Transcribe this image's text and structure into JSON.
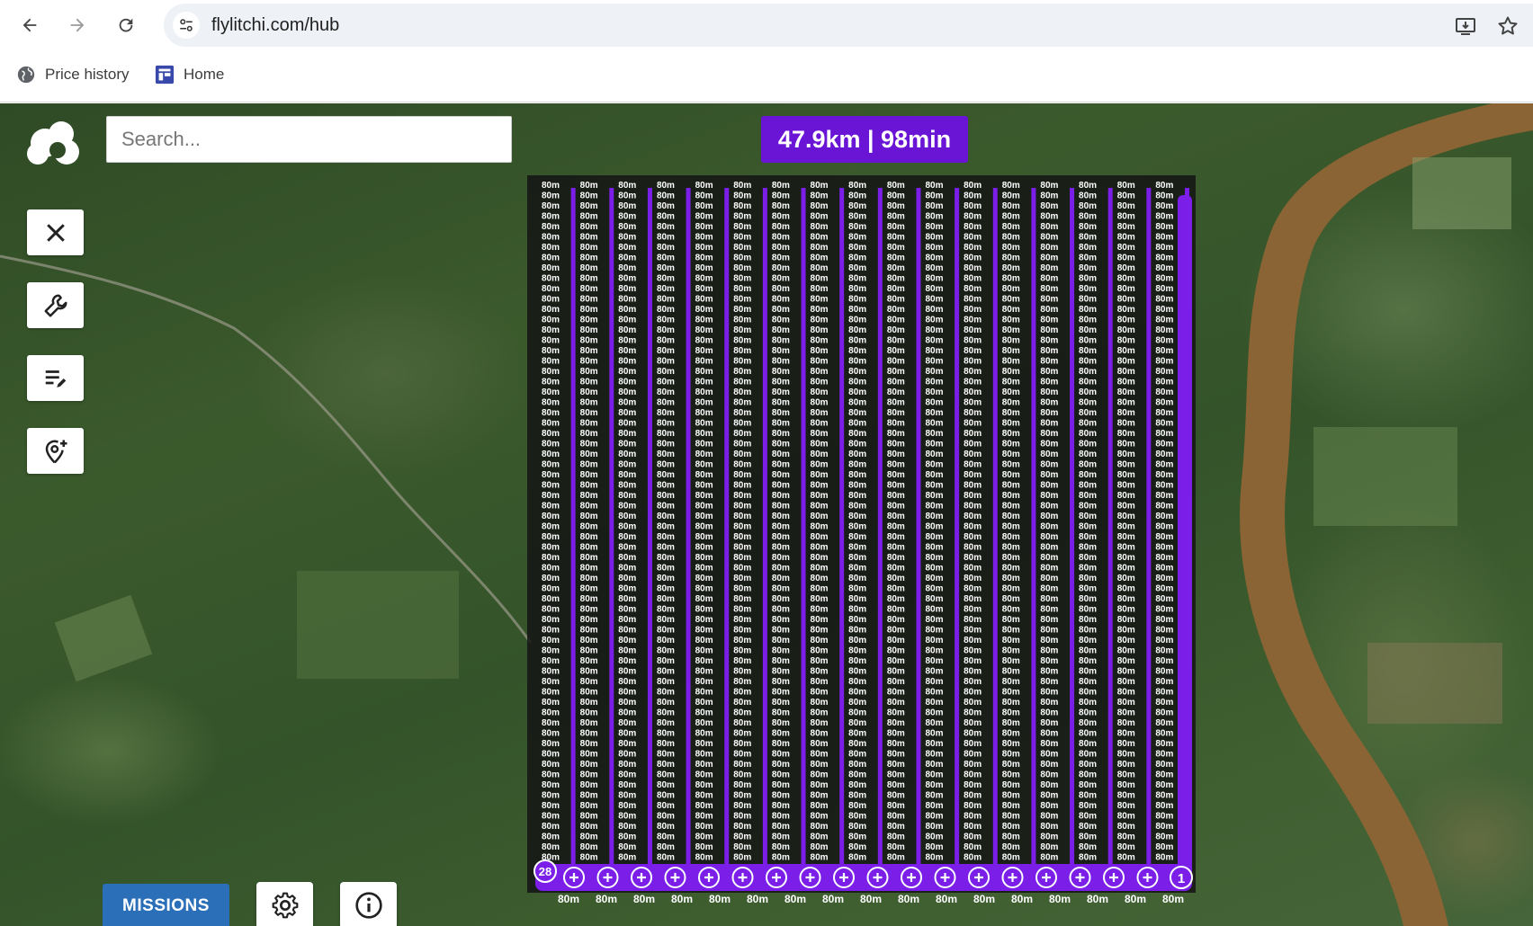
{
  "browser": {
    "url": "flylitchi.com/hub",
    "back_icon": "arrow-left-icon",
    "forward_icon": "arrow-right-icon",
    "reload_icon": "reload-icon",
    "install_icon": "install-app-icon",
    "bookmark_star_icon": "star-icon",
    "bookmarks": [
      {
        "label": "Price history",
        "icon": "globe-icon"
      },
      {
        "label": "Home",
        "icon": "dashboard-icon"
      }
    ]
  },
  "map": {
    "search": {
      "placeholder": "Search..."
    },
    "stats_label": "47.9km | 98min",
    "tools": [
      {
        "name": "close",
        "icon": "close-icon"
      },
      {
        "name": "settings-tools",
        "icon": "wrench-icon"
      },
      {
        "name": "edit-list",
        "icon": "edit-list-icon"
      },
      {
        "name": "add-poi",
        "icon": "add-location-icon"
      }
    ],
    "missions_label": "MISSIONS",
    "settings_icon": "gear-icon",
    "info_icon": "info-icon",
    "mission": {
      "waypoint_altitude_label": "80m",
      "first_waypoint_label": "1",
      "last_waypoint_label": "28",
      "path_color": "#7b1fe8",
      "waypoint_color": "#ffffff"
    }
  }
}
